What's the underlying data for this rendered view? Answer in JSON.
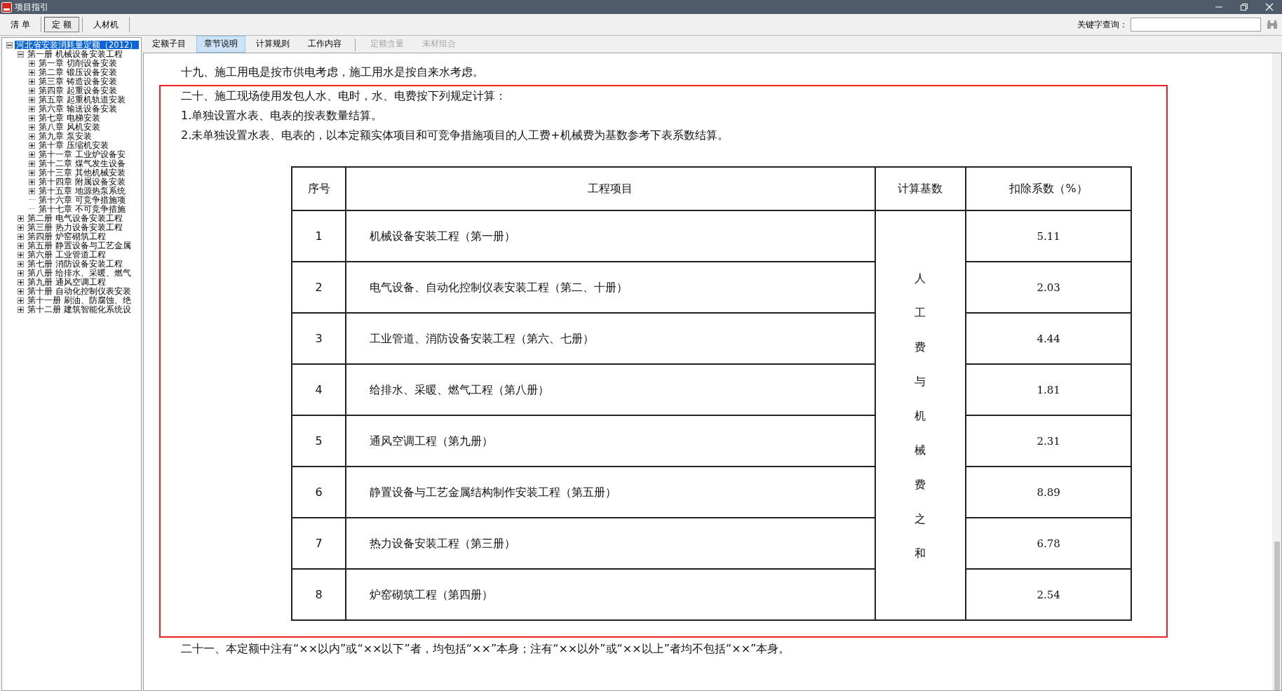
{
  "window": {
    "title": "项目指引"
  },
  "toolbar": {
    "buttons": [
      {
        "label": "清 单",
        "selected": false
      },
      {
        "label": "定 额",
        "selected": true
      },
      {
        "label": "人材机",
        "selected": false
      }
    ],
    "search_label": "关键字查询："
  },
  "tree": [
    {
      "label": "河北省安装消耗量定额（2012）",
      "kind": "folder",
      "expanded": true,
      "selected": true,
      "children": [
        {
          "label": "第一册 机械设备安装工程",
          "kind": "folder",
          "expanded": true,
          "selected": false,
          "children": [
            {
              "label": "第一章 切削设备安装",
              "kind": "folder",
              "expanded": false,
              "selected": false
            },
            {
              "label": "第二章 锻压设备安装",
              "kind": "folder",
              "expanded": false,
              "selected": false
            },
            {
              "label": "第三章 铸造设备安装",
              "kind": "folder",
              "expanded": false,
              "selected": false
            },
            {
              "label": "第四章 起重设备安装",
              "kind": "folder",
              "expanded": false,
              "selected": false
            },
            {
              "label": "第五章 起重机轨道安装",
              "kind": "folder",
              "expanded": false,
              "selected": false
            },
            {
              "label": "第六章 输送设备安装",
              "kind": "folder",
              "expanded": false,
              "selected": false
            },
            {
              "label": "第七章 电梯安装",
              "kind": "folder",
              "expanded": false,
              "selected": false
            },
            {
              "label": "第八章 风机安装",
              "kind": "folder",
              "expanded": false,
              "selected": false
            },
            {
              "label": "第九章 泵安装",
              "kind": "folder",
              "expanded": false,
              "selected": false
            },
            {
              "label": "第十章 压缩机安装",
              "kind": "folder",
              "expanded": false,
              "selected": false
            },
            {
              "label": "第十一章 工业炉设备安",
              "kind": "folder",
              "expanded": false,
              "selected": false
            },
            {
              "label": "第十二章 煤气发生设备",
              "kind": "folder",
              "expanded": false,
              "selected": false
            },
            {
              "label": "第十三章 其他机械安装",
              "kind": "folder",
              "expanded": false,
              "selected": false
            },
            {
              "label": "第十四章 附属设备安装",
              "kind": "folder",
              "expanded": false,
              "selected": false
            },
            {
              "label": "第十五章 地源热泵系统",
              "kind": "folder",
              "expanded": false,
              "selected": false
            },
            {
              "label": "第十六章 可竞争措施项",
              "kind": "leaf",
              "selected": false
            },
            {
              "label": "第十七章 不可竞争措施",
              "kind": "leaf",
              "selected": false
            }
          ]
        },
        {
          "label": "第二册 电气设备安装工程",
          "kind": "folder",
          "expanded": false,
          "selected": false
        },
        {
          "label": "第三册 热力设备安装工程",
          "kind": "folder",
          "expanded": false,
          "selected": false
        },
        {
          "label": "第四册 炉窑砌筑工程",
          "kind": "folder",
          "expanded": false,
          "selected": false
        },
        {
          "label": "第五册 静置设备与工艺金属",
          "kind": "folder",
          "expanded": false,
          "selected": false
        },
        {
          "label": "第六册 工业管道工程",
          "kind": "folder",
          "expanded": false,
          "selected": false
        },
        {
          "label": "第七册 消防设备安装工程",
          "kind": "folder",
          "expanded": false,
          "selected": false
        },
        {
          "label": "第八册 给排水、采暖、燃气",
          "kind": "folder",
          "expanded": false,
          "selected": false
        },
        {
          "label": "第九册 通风空调工程",
          "kind": "folder",
          "expanded": false,
          "selected": false
        },
        {
          "label": "第十册 自动化控制仪表安装",
          "kind": "folder",
          "expanded": false,
          "selected": false
        },
        {
          "label": "第十一册 刷油、防腐蚀、绝",
          "kind": "folder",
          "expanded": false,
          "selected": false
        },
        {
          "label": "第十二册 建筑智能化系统设",
          "kind": "folder",
          "expanded": false,
          "selected": false
        }
      ]
    }
  ],
  "tabs": [
    {
      "label": "定额子目",
      "selected": false,
      "disabled": false
    },
    {
      "label": "章节说明",
      "selected": true,
      "disabled": false
    },
    {
      "label": "计算规则",
      "selected": false,
      "disabled": false
    },
    {
      "label": "工作内容",
      "selected": false,
      "disabled": false
    },
    {
      "label": "定额含量",
      "selected": false,
      "disabled": true
    },
    {
      "label": "未材组合",
      "selected": false,
      "disabled": true
    }
  ],
  "document": {
    "paragraphs_before": [
      "十九、施工用电是按市供电考虑，施工用水是按自来水考虑。"
    ],
    "highlighted_section": {
      "highlighted": true,
      "paragraphs": [
        "二十、施工现场使用发包人水、电时，水、电费按下列规定计算：",
        "1.单独设置水表、电表的按表数量结算。",
        "2.未单独设置水表、电表的，以本定额实体项目和可竞争措施项目的人工费+机械费为基数参考下表系数结算。"
      ],
      "table": {
        "columns": [
          "序号",
          "工程项目",
          "计算基数",
          "扣除系数（%）"
        ],
        "basis": "人工费与机械费之和",
        "rows": [
          {
            "no": "1",
            "project": "机械设备安装工程（第一册）",
            "factor": "5.11"
          },
          {
            "no": "2",
            "project": "电气设备、自动化控制仪表安装工程（第二、十册）",
            "factor": "2.03"
          },
          {
            "no": "3",
            "project": "工业管道、消防设备安装工程（第六、七册）",
            "factor": "4.44"
          },
          {
            "no": "4",
            "project": "给排水、采暖、燃气工程（第八册）",
            "factor": "1.81"
          },
          {
            "no": "5",
            "project": "通风空调工程（第九册）",
            "factor": "2.31"
          },
          {
            "no": "6",
            "project": "静置设备与工艺金属结构制作安装工程（第五册）",
            "factor": "8.89"
          },
          {
            "no": "7",
            "project": "热力设备安装工程（第三册）",
            "factor": "6.78"
          },
          {
            "no": "8",
            "project": "炉窑砌筑工程（第四册）",
            "factor": "2.54"
          }
        ]
      }
    },
    "paragraphs_after": [
      "二十一、本定额中注有“××以内”或“××以下”者，均包括“××”本身；注有“××以外”或“××以上”者均不包括“××”本身。"
    ]
  }
}
